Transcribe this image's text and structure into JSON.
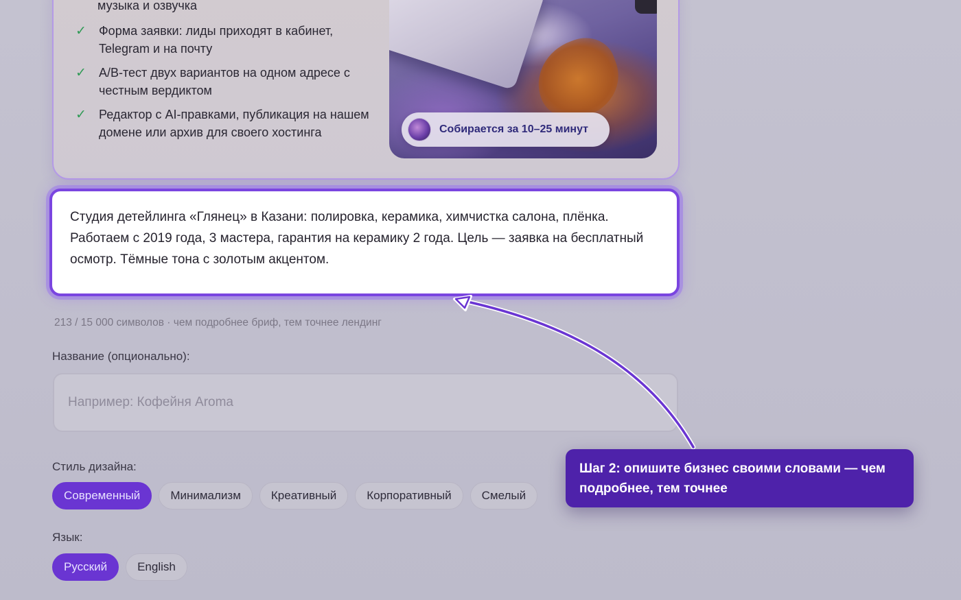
{
  "features": {
    "partial_line": "музыка и озвучка",
    "items": [
      {
        "text": "Форма заявки: лиды приходят в кабинет, Telegram и на почту"
      },
      {
        "text": "A/B-тест двух вариантов на одном адресе с честным вердиктом"
      },
      {
        "text": "Редактор с AI-правками, публикация на нашем домене или архив для своего хостинга"
      }
    ],
    "check_icon": "✓"
  },
  "promo": {
    "badge_text": "Собирается за 10–25 минут"
  },
  "brief": {
    "value": "Студия детейлинга «Глянец» в Казани: полировка, керамика, химчистка салона, плёнка. Работаем с 2019 года, 3 мастера, гарантия на керамику 2 года. Цель — заявка на бесплатный осмотр. Тёмные тона с золотым акцентом.",
    "counter": "213 / 15 000 символов · чем подробнее бриф, тем точнее лендинг"
  },
  "name_field": {
    "label": "Название (опционально):",
    "placeholder": "Например: Кофейня Aroma",
    "value": ""
  },
  "style": {
    "label": "Стиль дизайна:",
    "options": [
      "Современный",
      "Минимализм",
      "Креативный",
      "Корпоративный",
      "Смелый"
    ],
    "selected": "Современный"
  },
  "language": {
    "label": "Язык:",
    "options": [
      "Русский",
      "English"
    ],
    "selected": "Русский"
  },
  "tooltip": {
    "text": "Шаг 2: опишите бизнес своими словами — чем подробнее, тем точнее"
  },
  "colors": {
    "accent": "#6a35d2",
    "tooltip_bg": "#4e22aa",
    "check": "#2f9a55",
    "highlight_border": "#7a45e0"
  }
}
